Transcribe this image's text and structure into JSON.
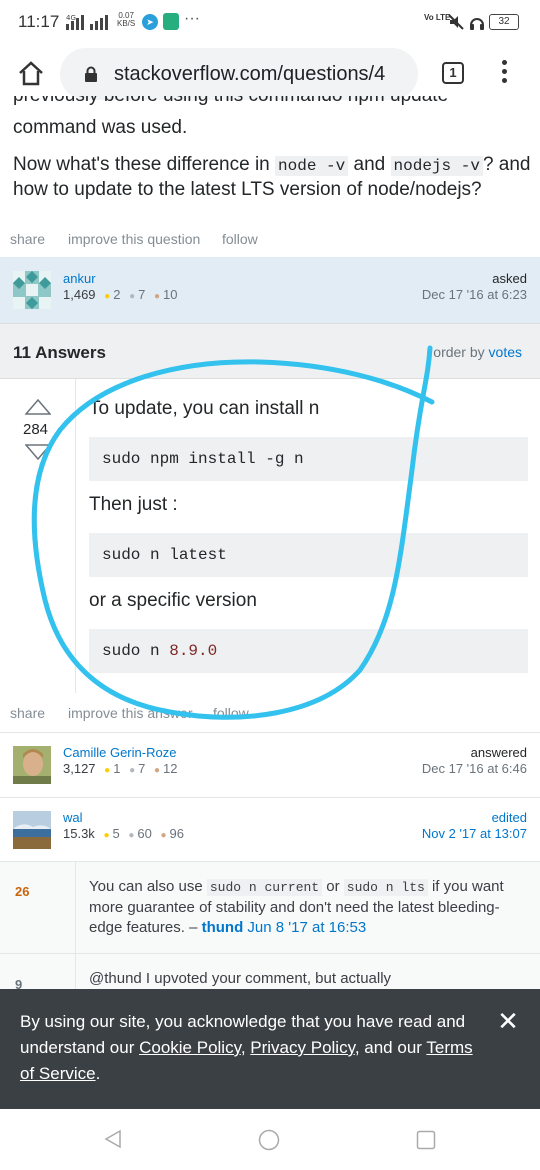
{
  "status_bar": {
    "time": "11:17",
    "network": "4G",
    "speed_value": "0.07",
    "speed_unit": "KB/S",
    "more": "···",
    "volte": "Vo LTE",
    "battery": "32"
  },
  "browser": {
    "url": "stackoverflow.com/questions/4",
    "tab_count": "1"
  },
  "question": {
    "cut_line": "previously before using this commando npm update",
    "line1": "command was used.",
    "line2_pre": "Now what's these difference in ",
    "code1": "node -v",
    "line2_mid": " and ",
    "code2": "nodejs -v",
    "line2_post": "? and",
    "line3": "how to update to the latest LTS version of node/nodejs?",
    "menu": {
      "share": "share",
      "improve": "improve this question",
      "follow": "follow"
    },
    "owner": {
      "name": "ankur",
      "rep": "1,469",
      "gold": "2",
      "silver": "7",
      "bronze": "10",
      "action": "asked",
      "date": "Dec 17 '16 at 6:23"
    }
  },
  "answers_header": {
    "count": "11 Answers",
    "order_label": "order by",
    "order_value": "votes"
  },
  "answer": {
    "votes": "284",
    "p1": "To update, you can install n",
    "code1": "sudo npm install -g n",
    "p2": "Then just :",
    "code2": "sudo n latest",
    "p3": "or a specific version",
    "code3_cmd": "sudo n ",
    "code3_num": "8.9.0",
    "menu": {
      "share": "share",
      "improve": "improve this answer",
      "follow": "follow"
    },
    "author": {
      "name": "Camille Gerin-Roze",
      "rep": "3,127",
      "gold": "1",
      "silver": "7",
      "bronze": "12",
      "action": "answered",
      "date": "Dec 17 '16 at 6:46"
    },
    "editor": {
      "name": "wal",
      "rep": "15.3k",
      "gold": "5",
      "silver": "60",
      "bronze": "96",
      "action": "edited",
      "date": "Nov 2 '17 at 13:07"
    }
  },
  "comments": [
    {
      "score": "26",
      "t1": "You can also use ",
      "c1": "sudo n current",
      "t2": " or ",
      "c2": "sudo n lts",
      "t3": " if you want more guarantee of stability and don't need the latest bleeding-edge features. – ",
      "user": "thund",
      "date": "Jun 8 '17 at 16:53"
    },
    {
      "score": "9",
      "text": "@thund I upvoted your comment, but actually"
    }
  ],
  "cookie": {
    "t1": "By using our site, you acknowledge that you have read and understand our ",
    "link1": "Cookie Policy",
    "t2": ", ",
    "link2": "Privacy Policy",
    "t3": ", and our ",
    "link3": "Terms of Service",
    "t4": ".",
    "close": "✕"
  },
  "colors": {
    "link": "#0077cc",
    "accent_annotation": "#33c1ee",
    "owner_card_bg": "#e1ecf4",
    "cookie_bg": "#3b4045"
  }
}
